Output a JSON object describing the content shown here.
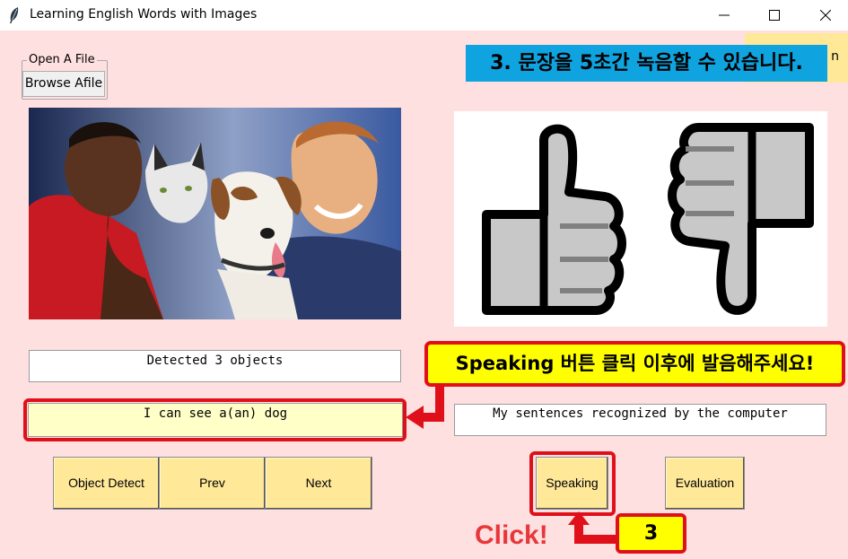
{
  "window": {
    "title": "Learning English Words with Images"
  },
  "file_group": {
    "label": "Open A File",
    "browse_label": "Browse Afile"
  },
  "banner": {
    "text": "3. 문장을 5초간 녹음할 수 있습니다."
  },
  "hidden_button": {
    "label": "n"
  },
  "detect_output": "Detected 3 objects",
  "sentence_output": "I can see a(an) dog",
  "recognized_output": "My sentences recognized by the computer",
  "buttons": {
    "object_detect": "Object Detect",
    "prev": "Prev",
    "next": "Next",
    "speaking": "Speaking",
    "evaluation": "Evaluation"
  },
  "callout": {
    "text": "Speaking 버튼 클릭 이후에 발음해주세요!"
  },
  "step_badge": "3",
  "click_label": "Click!",
  "colors": {
    "background": "#ffe0e0",
    "button": "#ffe898",
    "banner": "#0fa3df",
    "highlight": "#e0101a",
    "callout_bg": "#ffff00"
  },
  "icons": [
    "feather-icon",
    "minimize-icon",
    "maximize-icon",
    "close-icon",
    "thumbs-up-icon",
    "thumbs-down-icon"
  ]
}
